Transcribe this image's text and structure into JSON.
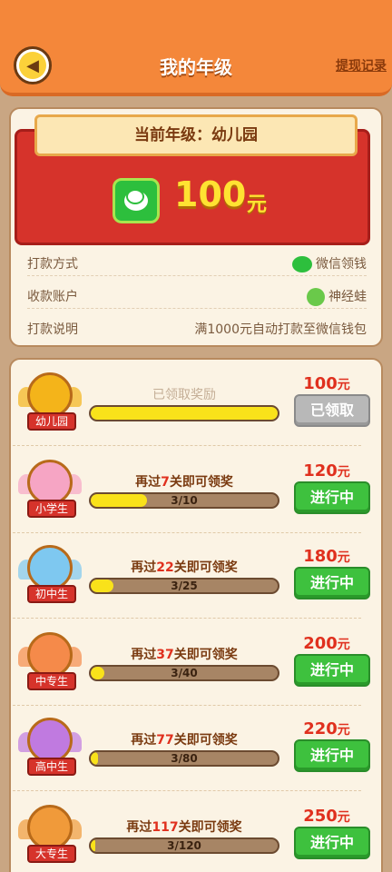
{
  "header": {
    "title": "我的年级",
    "record_link": "提现记录"
  },
  "current": {
    "grade_text": "当前年级：幼儿园",
    "amount": "100",
    "unit": "元"
  },
  "info": [
    {
      "key": "打款方式",
      "value": "微信领钱",
      "icon": "wechat-icon"
    },
    {
      "key": "收款账户",
      "value": "神经蛙",
      "icon": "frog-avatar-icon"
    },
    {
      "key": "打款说明",
      "value": "满1000元自动打款至微信钱包",
      "icon": ""
    }
  ],
  "grades": [
    {
      "label": "幼儿园",
      "status_text": "已领取奖励",
      "task_pre": "",
      "task_num": "",
      "task_post": "",
      "progress_text": "",
      "progress": 1.0,
      "reward": "100",
      "unit": "元",
      "button": "已领取",
      "button_state": "done",
      "badge_color": "#f4b41a",
      "badge_icon": "star-icon"
    },
    {
      "label": "小学生",
      "status_text": "",
      "task_pre": "再过",
      "task_num": "7",
      "task_post": "关即可领奖",
      "progress_text": "3/10",
      "progress": 0.3,
      "reward": "120",
      "unit": "元",
      "button": "进行中",
      "button_state": "active",
      "badge_color": "#f6a5c4",
      "badge_icon": "moon-icon"
    },
    {
      "label": "初中生",
      "status_text": "",
      "task_pre": "再过",
      "task_num": "22",
      "task_post": "关即可领奖",
      "progress_text": "3/25",
      "progress": 0.12,
      "reward": "180",
      "unit": "元",
      "button": "进行中",
      "button_state": "active",
      "badge_color": "#7ec8f0",
      "badge_icon": "gem-icon"
    },
    {
      "label": "中专生",
      "status_text": "",
      "task_pre": "再过",
      "task_num": "37",
      "task_post": "关即可领奖",
      "progress_text": "3/40",
      "progress": 0.075,
      "reward": "200",
      "unit": "元",
      "button": "进行中",
      "button_state": "active",
      "badge_color": "#f58a4a",
      "badge_icon": "ruby-icon"
    },
    {
      "label": "高中生",
      "status_text": "",
      "task_pre": "再过",
      "task_num": "77",
      "task_post": "关即可领奖",
      "progress_text": "3/80",
      "progress": 0.04,
      "reward": "220",
      "unit": "元",
      "button": "进行中",
      "button_state": "active",
      "badge_color": "#c07ae0",
      "badge_icon": "heart-icon"
    },
    {
      "label": "大专生",
      "status_text": "",
      "task_pre": "再过",
      "task_num": "117",
      "task_post": "关即可领奖",
      "progress_text": "3/120",
      "progress": 0.025,
      "reward": "250",
      "unit": "元",
      "button": "进行中",
      "button_state": "active",
      "badge_color": "#f09a3a",
      "badge_icon": "diamond-icon"
    }
  ]
}
